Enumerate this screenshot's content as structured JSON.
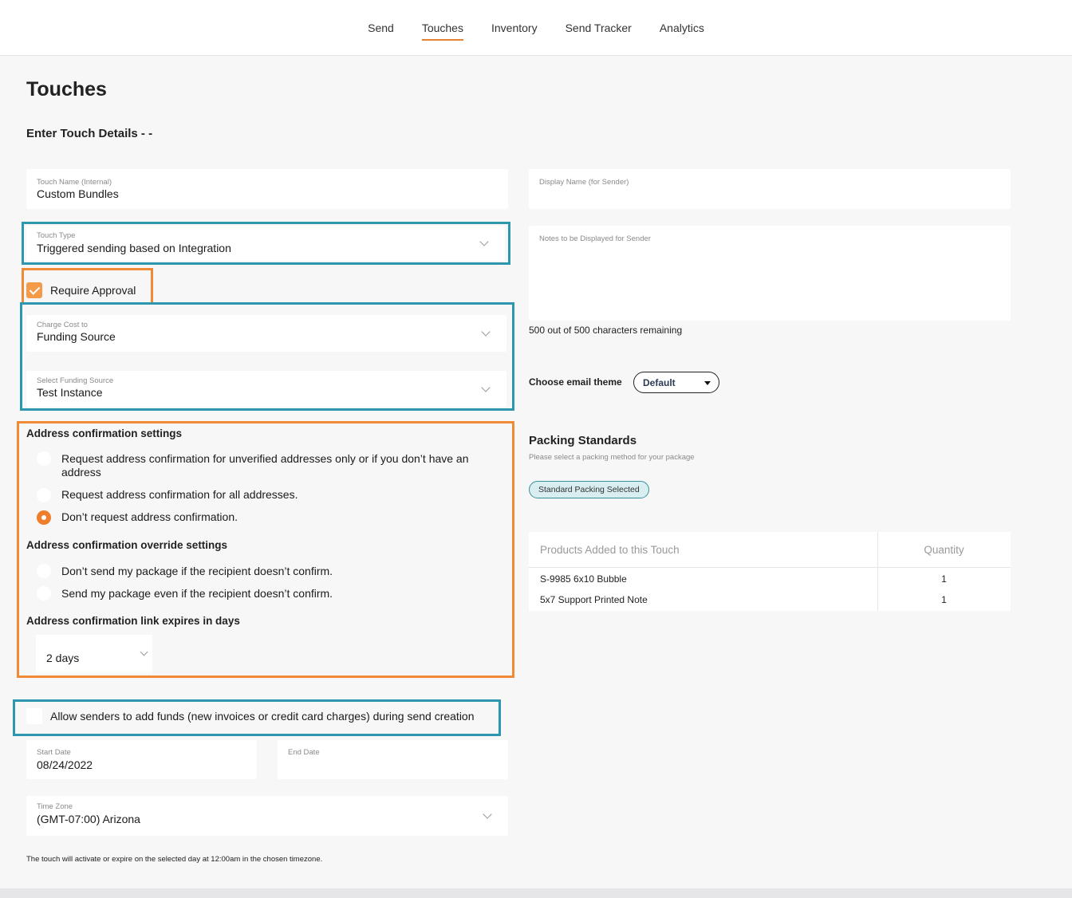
{
  "nav": {
    "tabs": [
      {
        "label": "Send"
      },
      {
        "label": "Touches"
      },
      {
        "label": "Inventory"
      },
      {
        "label": "Send Tracker"
      },
      {
        "label": "Analytics"
      }
    ],
    "active": "Touches"
  },
  "page": {
    "title": "Touches",
    "section_title": "Enter Touch Details - -"
  },
  "form": {
    "touch_name": {
      "label": "Touch Name (Internal)",
      "value": "Custom Bundles"
    },
    "display_name": {
      "label": "Display Name (for Sender)",
      "value": ""
    },
    "touch_type": {
      "label": "Touch Type",
      "value": "Triggered sending based on Integration"
    },
    "notes": {
      "label": "Notes to be Displayed for Sender",
      "value": ""
    },
    "require_approval": {
      "label": "Require Approval",
      "checked": true
    },
    "charge_cost": {
      "label": "Charge Cost to",
      "value": "Funding Source"
    },
    "funding_source": {
      "label": "Select Funding Source",
      "value": "Test Instance"
    },
    "notes_counter": "500 out of 500 characters remaining",
    "email_theme": {
      "label": "Choose email theme",
      "value": "Default"
    },
    "address_confirmation": {
      "title": "Address confirmation settings",
      "options": [
        {
          "label": "Request address confirmation for unverified addresses only or if you don’t have an address",
          "selected": false
        },
        {
          "label": "Request address confirmation for all addresses.",
          "selected": false
        },
        {
          "label": "Don’t request address confirmation.",
          "selected": true
        }
      ]
    },
    "override": {
      "title": "Address confirmation override settings",
      "options": [
        {
          "label": "Don’t send my package if the recipient doesn’t confirm.",
          "selected": false
        },
        {
          "label": "Send my package even if the recipient doesn’t confirm.",
          "selected": false
        }
      ]
    },
    "expiry": {
      "title": "Address confirmation link expires in days",
      "value": "2 days"
    },
    "allow_funds": {
      "label": "Allow senders to add funds (new invoices or credit card charges) during send creation",
      "checked": false
    },
    "start_date": {
      "label": "Start Date",
      "value": "08/24/2022"
    },
    "end_date": {
      "label": "End Date",
      "value": ""
    },
    "time_zone": {
      "label": "Time Zone",
      "value": "(GMT-07:00) Arizona"
    },
    "footnote": "The touch will activate or expire on the selected day at 12:00am in the chosen timezone."
  },
  "packing": {
    "title": "Packing Standards",
    "subtitle": "Please select a packing method for your package",
    "badge": "Standard Packing Selected"
  },
  "products": {
    "headers": {
      "name": "Products Added to this Touch",
      "qty": "Quantity"
    },
    "rows": [
      {
        "name": "S-9985 6x10 Bubble",
        "qty": "1"
      },
      {
        "name": "5x7 Support Printed Note",
        "qty": "1"
      }
    ]
  },
  "colors": {
    "accent_orange": "#ee7d2c",
    "highlight_teal": "#2c97ad",
    "highlight_orange": "#f08a34"
  }
}
